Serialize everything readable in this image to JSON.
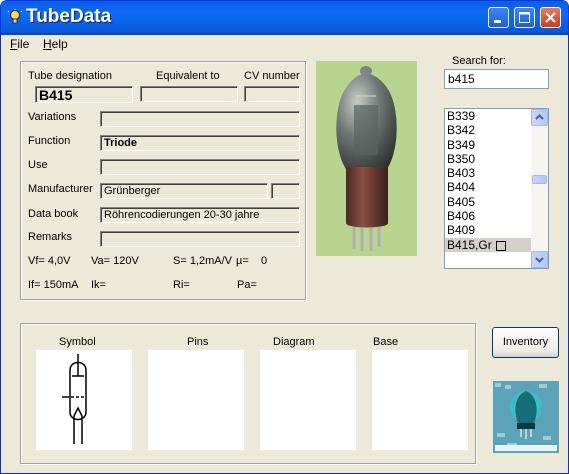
{
  "window": {
    "title": "TubeData",
    "accent": "#0a5de8"
  },
  "menu": [
    {
      "label": "File",
      "key": "F",
      "rest": "ile"
    },
    {
      "label": "Help",
      "key": "H",
      "rest": "elp"
    }
  ],
  "labels": {
    "tube_designation": "Tube designation",
    "equivalent_to": "Equivalent to",
    "cv_number": "CV number",
    "variations": "Variations",
    "function": "Function",
    "use": "Use",
    "manufacturer": "Manufacturer",
    "data_book": "Data book",
    "remarks": "Remarks"
  },
  "values": {
    "tube_designation": "B415",
    "equivalent_to": "",
    "cv_number": "",
    "variations": "",
    "function": "Triode",
    "use": "",
    "manufacturer": "Grünberger",
    "manufacturer_extra": "",
    "data_book": "Röhrencodierungen 20-30 jahre",
    "remarks": ""
  },
  "specs": {
    "vf": "Vf= 4,0V",
    "va": "Va= 120V",
    "s": "S= 1,2mA/V",
    "mu": "µ=",
    "mu_value": "0",
    "if": "If= 150mA",
    "ik": "Ik=",
    "ri": "Ri=",
    "pa": "Pa="
  },
  "search": {
    "label": "Search for:",
    "value": "b415"
  },
  "results": [
    "B339",
    "B342",
    "B349",
    "B350",
    "B403",
    "B404",
    "B405",
    "B406",
    "B409",
    "B415,Gr"
  ],
  "selected_result": "B415,Gr",
  "panels": {
    "symbol": "Symbol",
    "pins": "Pins",
    "diagram": "Diagram",
    "base": "Base"
  },
  "buttons": {
    "inventory": "Inventory"
  },
  "icons": {
    "app": "lightbulb-icon",
    "minimize": "minimize-icon",
    "maximize": "maximize-icon",
    "close": "close-icon"
  }
}
